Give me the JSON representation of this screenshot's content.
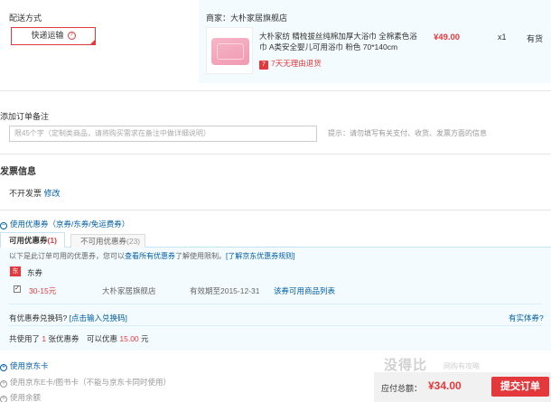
{
  "delivery": {
    "title": "配送方式",
    "option_label": "快递运输",
    "help_glyph": "?"
  },
  "order_item": {
    "vendor": "商家：大朴家居旗舰店",
    "product_name": "大朴家纺 精梳拔丝纯棉加厚大浴巾 全棉素色浴巾 A类安全婴儿可用浴巾 粉色 70*140cm",
    "return_badge": "7",
    "return_text": "7天无理由退货",
    "price": "¥49.00",
    "quantity": "x1",
    "stock": "有货"
  },
  "remarks": {
    "label": "添加订单备注",
    "placeholder": "限45个字（定制类商品，请将购买需求在备注中做详细说明）",
    "tip": "提示：请勿填写有关支付、收货、发票方面的信息"
  },
  "invoice": {
    "title": "发票信息",
    "value": "不开发票",
    "edit_link": "修改"
  },
  "coupons": {
    "toggle_label": "使用优惠券（京券/东券/免运费券）",
    "tab_available": "可用优惠券",
    "tab_available_count": "(1)",
    "tab_unavailable": "不可用优惠券",
    "tab_unavailable_count": "(23)",
    "note_prefix": "以下是此订单可用的优惠券，您可以",
    "note_link": "查看所有优惠券",
    "note_mid": "了解使用限制。",
    "note_link2": "[了解京东优惠券规则]",
    "type_badge": "东",
    "type_label": "东券",
    "coupon": {
      "checked": true,
      "value": "30-15元",
      "shop": "大朴家居旗舰店",
      "valid": "有效期至2015-12-31",
      "goods_link": "该券可用商品列表"
    },
    "code_question": "有优惠券兑换码?",
    "code_link": "[点击输入兑换码]",
    "physical_link": "有实体券?",
    "used_prefix": "共使用了",
    "used_count": "1",
    "used_mid": "张优惠券　可以优惠",
    "used_amount": "15.00",
    "used_suffix": "元"
  },
  "jd_card": {
    "label": "使用京东卡"
  },
  "ecard": {
    "label": "使用京东E卡/图书卡（不能与京东卡同时使用）"
  },
  "balance": {
    "label": "使用余额"
  },
  "checkout": {
    "due_label": "应付总额：",
    "due_amount": "¥34.00",
    "submit_label": "提交订单"
  },
  "watermark": {
    "main": "没得比",
    "sub": "网购有攻略"
  },
  "colors": {
    "accent": "#e4393c",
    "link": "#005ea7",
    "panel": "#f3fbfe"
  }
}
